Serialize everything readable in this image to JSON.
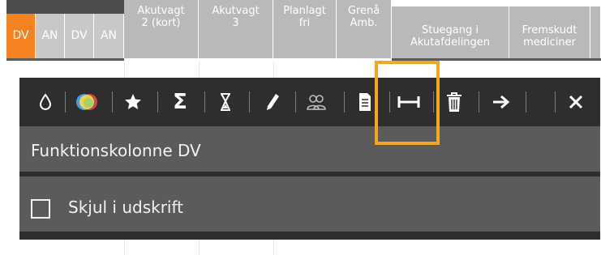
{
  "header": {
    "columns": [
      {
        "label": "Akutvagt\n2 (kort)"
      },
      {
        "label": "Akutvagt\n3"
      },
      {
        "label": "Planlagt\nfri"
      },
      {
        "label": "Grenå\nAmb."
      },
      {
        "label": "Stuegang i\nAkutafdelingen"
      },
      {
        "label": "Fremskudt\nmediciner"
      }
    ],
    "codes": [
      {
        "label": "DV",
        "active": true
      },
      {
        "label": "AN",
        "active": false
      },
      {
        "label": "DV",
        "active": false
      },
      {
        "label": "AN",
        "active": false
      }
    ]
  },
  "toolbar": {
    "icons": [
      {
        "name": "drop-icon",
        "glyph": "💧"
      },
      {
        "name": "color-palette-icon",
        "glyph": "●"
      },
      {
        "name": "star-icon",
        "glyph": "★"
      },
      {
        "name": "sum-icon",
        "glyph": "Σ"
      },
      {
        "name": "hourglass-icon",
        "glyph": "⧗"
      },
      {
        "name": "pencil-icon",
        "glyph": "✎"
      },
      {
        "name": "users-icon",
        "glyph": "👥"
      },
      {
        "name": "document-icon",
        "glyph": "▤"
      },
      {
        "name": "column-width-icon",
        "glyph": "⊢⊣"
      },
      {
        "name": "trash-icon",
        "glyph": "🗑"
      },
      {
        "name": "arrow-right-icon",
        "glyph": "➔"
      },
      {
        "name": "close-icon",
        "glyph": "✕"
      }
    ]
  },
  "panel": {
    "title": "Funktionskolonne DV",
    "checkbox_label": "Skjul i udskrift",
    "checkbox_checked": false
  },
  "colors": {
    "active_code": "#f58220",
    "highlight": "#f0a820",
    "toolbar_bg": "#2e2e2e",
    "panel_bg": "#5b5b5b"
  }
}
